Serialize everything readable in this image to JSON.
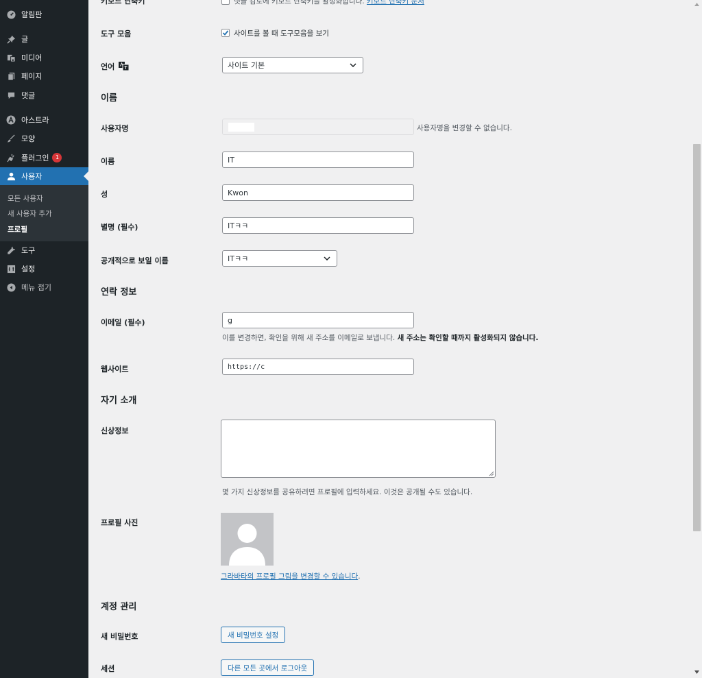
{
  "sidebar": {
    "dashboard": "알림판",
    "posts": "글",
    "media": "미디어",
    "pages": "페이지",
    "comments": "댓글",
    "astra": "아스트라",
    "appearance": "모양",
    "plugins": "플러그인",
    "plugins_badge": "1",
    "users": "사용자",
    "submenu": {
      "all_users": "모든 사용자",
      "add_new": "새 사용자 추가",
      "profile": "프로필"
    },
    "tools": "도구",
    "settings": "설정",
    "collapse": "메뉴 접기"
  },
  "profile": {
    "keyboard_shortcuts": {
      "label": "키보드 단축키",
      "desc": "댓글 검토에 키보드 단축키를 활성화합니다.",
      "link": "키보드 단축키 문서"
    },
    "toolbar": {
      "label": "도구 모음",
      "checkbox_label": "사이트를 볼 때 도구모음을 보기",
      "checked": true
    },
    "language": {
      "label": "언어",
      "selected": "사이트 기본"
    },
    "name_section": "이름",
    "username": {
      "label": "사용자명",
      "value": "",
      "desc": "사용자명을 변경할 수 없습니다."
    },
    "first_name": {
      "label": "이름",
      "value": "IT"
    },
    "last_name": {
      "label": "성",
      "value": "Kwon"
    },
    "nickname": {
      "label": "별명 (필수)",
      "value": "ITㅋㅋ"
    },
    "display_name": {
      "label": "공개적으로 보일 이름",
      "selected": "ITㅋㅋ"
    },
    "contact_section": "연락 정보",
    "email": {
      "label": "이메일 (필수)",
      "value": "g",
      "desc": "이를 변경하면, 확인을 위해 새 주소를 이메일로 보냅니다.",
      "desc_bold": "새 주소는 확인할 때까지 활성화되지 않습니다."
    },
    "website": {
      "label": "웹사이트",
      "value": "https://c"
    },
    "about_section": "자기 소개",
    "bio": {
      "label": "신상정보",
      "value": "",
      "desc": "몇 가지 신상정보를 공유하려면 프로필에 입력하세요. 이것은 공개될 수도 있습니다."
    },
    "avatar": {
      "label": "프로필 사진",
      "link": "그라바타의 프로필 그림을 변경할 수 있습니다",
      "link_suffix": "."
    },
    "account_section": "계정 관리",
    "new_password": {
      "label": "새 비밀번호",
      "button": "새 비밀번호 설정"
    },
    "sessions": {
      "label": "세션",
      "button": "다른 모든 곳에서 로그아웃"
    }
  },
  "colors": {
    "sidebar_bg": "#1d2327",
    "accent": "#2271b1",
    "badge": "#d63638",
    "page_bg": "#f0f0f1"
  }
}
